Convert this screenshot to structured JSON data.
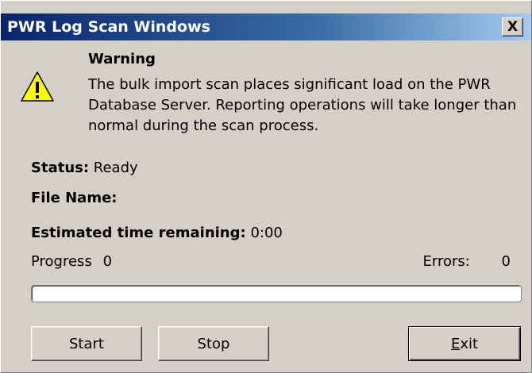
{
  "window": {
    "title": "PWR Log Scan Windows",
    "close_glyph": "X",
    "close_icon": "close-icon"
  },
  "warning": {
    "icon": "warning-icon",
    "heading": "Warning",
    "body": "The bulk import scan places significant load on the PWR Database Server. Reporting operations will take longer than normal during the scan process."
  },
  "status": {
    "label": "Status:",
    "value": "Ready"
  },
  "file_name": {
    "label": "File Name:",
    "value": ""
  },
  "eta": {
    "label": "Estimated time remaining:",
    "value": "0:00"
  },
  "progress": {
    "label": "Progress",
    "value": "0",
    "fraction": 0
  },
  "errors": {
    "label": "Errors:",
    "value": "0"
  },
  "buttons": {
    "start": "Start",
    "stop": "Stop",
    "exit_mnemonic": "E",
    "exit_rest": "xit"
  },
  "colors": {
    "title_bar": "#0a246a",
    "face": "#d4d0c8",
    "warning_yellow": "#ffff00"
  }
}
